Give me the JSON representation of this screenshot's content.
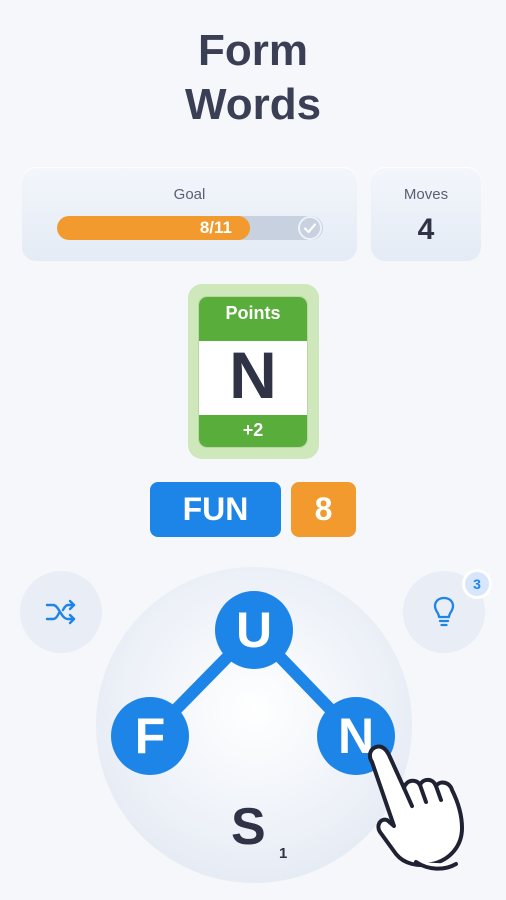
{
  "header": {
    "title_line1": "Form",
    "title_line2": "Words"
  },
  "goal": {
    "label": "Goal",
    "progress_text": "8/11",
    "progress_fraction": 0.727
  },
  "moves": {
    "label": "Moves",
    "value": "4"
  },
  "bonus_card": {
    "top_label": "Points",
    "letter": "N",
    "bonus": "+2"
  },
  "current_word": {
    "word": "FUN",
    "score": "8"
  },
  "hint": {
    "count": "3"
  },
  "letter_wheel": {
    "letters": [
      "U",
      "F",
      "N",
      "S"
    ],
    "selected": [
      "F",
      "U",
      "N"
    ],
    "s_subscript": "1"
  },
  "colors": {
    "accent_blue": "#1d85e7",
    "accent_orange": "#f29a2e",
    "card_green": "#59ad3a"
  },
  "icons": [
    "shuffle-icon",
    "lightbulb-icon",
    "check-icon",
    "pointing-hand-icon"
  ]
}
